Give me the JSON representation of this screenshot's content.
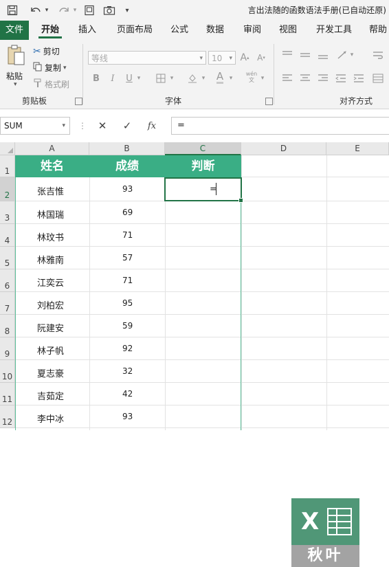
{
  "quick_access": {
    "save_icon": "save-icon",
    "undo_icon": "undo-icon",
    "redo_icon": "redo-icon",
    "doc_title": "言出法随的函数语法手册(已自动还原)"
  },
  "tabs": [
    "文件",
    "开始",
    "插入",
    "页面布局",
    "公式",
    "数据",
    "审阅",
    "视图",
    "开发工具",
    "帮助"
  ],
  "active_tab": "开始",
  "ribbon": {
    "clipboard": {
      "paste": "粘贴",
      "cut": "剪切",
      "copy": "复制",
      "format_painter": "格式刷",
      "group_label": "剪贴板"
    },
    "font": {
      "font_name": "等线",
      "font_size": "10",
      "bold": "B",
      "italic": "I",
      "underline": "U",
      "group_label": "字体"
    },
    "alignment": {
      "group_label": "对齐方式"
    }
  },
  "formula_bar": {
    "name_box": "SUM",
    "cancel": "✕",
    "enter": "✓",
    "fx": "fx",
    "content": "="
  },
  "columns": [
    "A",
    "B",
    "C",
    "D",
    "E"
  ],
  "selected_column": "C",
  "rows": [
    "1",
    "2",
    "3",
    "4",
    "5",
    "6",
    "7",
    "8",
    "9",
    "10",
    "11",
    "12"
  ],
  "selected_row": "2",
  "table": {
    "headers": [
      "姓名",
      "成绩",
      "判断"
    ],
    "records": [
      {
        "name": "张吉惟",
        "score": "93"
      },
      {
        "name": "林国瑞",
        "score": "69"
      },
      {
        "name": "林玟书",
        "score": "71"
      },
      {
        "name": "林雅南",
        "score": "57"
      },
      {
        "name": "江奕云",
        "score": "71"
      },
      {
        "name": "刘柏宏",
        "score": "95"
      },
      {
        "name": "阮建安",
        "score": "59"
      },
      {
        "name": "林子帆",
        "score": "92"
      },
      {
        "name": "夏志豪",
        "score": "32"
      },
      {
        "name": "吉茹定",
        "score": "42"
      },
      {
        "name": "李中冰",
        "score": "93"
      }
    ],
    "active_cell_text": "="
  },
  "watermark": {
    "letter": "X",
    "label": "秋叶"
  },
  "colors": {
    "excel_green": "#217346",
    "header_fill": "#3aae85"
  }
}
